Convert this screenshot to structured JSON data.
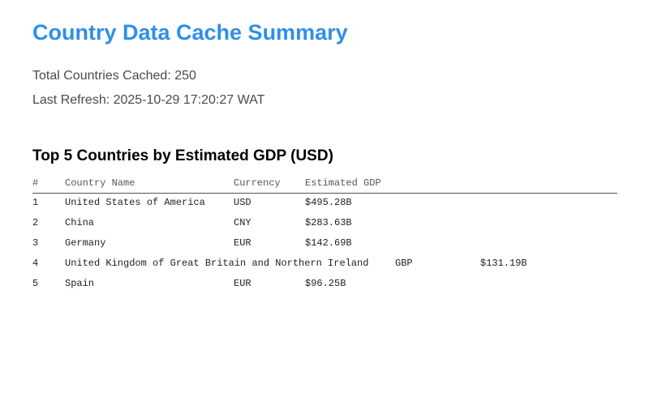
{
  "header": {
    "title": "Country Data Cache Summary"
  },
  "summary": {
    "total_label": "Total Countries Cached: 250",
    "refresh_label": "Last Refresh: 2025-10-29 17:20:27 WAT"
  },
  "top_table": {
    "title": "Top 5 Countries by Estimated GDP (USD)",
    "columns": [
      "#",
      "Country Name",
      "Currency",
      "Estimated GDP"
    ],
    "rows": [
      {
        "rank": "1",
        "name": "United States of America",
        "currency": "USD",
        "gdp": "$495.28B"
      },
      {
        "rank": "2",
        "name": "China",
        "currency": "CNY",
        "gdp": "$283.63B"
      },
      {
        "rank": "3",
        "name": "Germany",
        "currency": "EUR",
        "gdp": "$142.69B"
      },
      {
        "rank": "4",
        "name": "United Kingdom of Great Britain and Northern Ireland",
        "currency": "GBP",
        "gdp": "$131.19B"
      },
      {
        "rank": "5",
        "name": "Spain",
        "currency": "EUR",
        "gdp": "$96.25B"
      }
    ]
  }
}
